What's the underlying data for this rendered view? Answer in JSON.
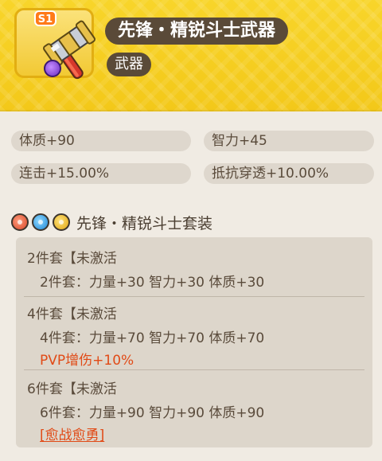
{
  "item": {
    "grade": "S1",
    "name": "先锋・精锐斗士武器",
    "type": "武器",
    "icon": "hammer-icon",
    "element_icon": "purple-element-icon"
  },
  "stats": [
    {
      "text": "体质+90"
    },
    {
      "text": "智力+45"
    },
    {
      "text": "连击+15.00%"
    },
    {
      "text": "抵抗穿透+10.00%"
    }
  ],
  "set": {
    "icons": [
      "red-gem-icon",
      "blue-gem-icon",
      "gold-gem-icon"
    ],
    "name": "先锋・精锐斗士套装",
    "tiers": [
      {
        "head": "2件套【未激活",
        "bonus": "2件套：力量+30 智力+30 体质+30",
        "extra": ""
      },
      {
        "head": "4件套【未激活",
        "bonus": "4件套：力量+70 智力+70 体质+70",
        "extra": "PVP增伤+10%"
      },
      {
        "head": "6件套【未激活",
        "bonus": "6件套：力量+90 智力+90 体质+90",
        "extra": "[愈战愈勇]"
      }
    ]
  },
  "colors": {
    "header": "#f6cf1e",
    "pill_dark": "#5a4a38",
    "stat_bg": "#ded7cd",
    "panel_bg": "#ddd6cb",
    "accent_text": "#e14a16"
  }
}
